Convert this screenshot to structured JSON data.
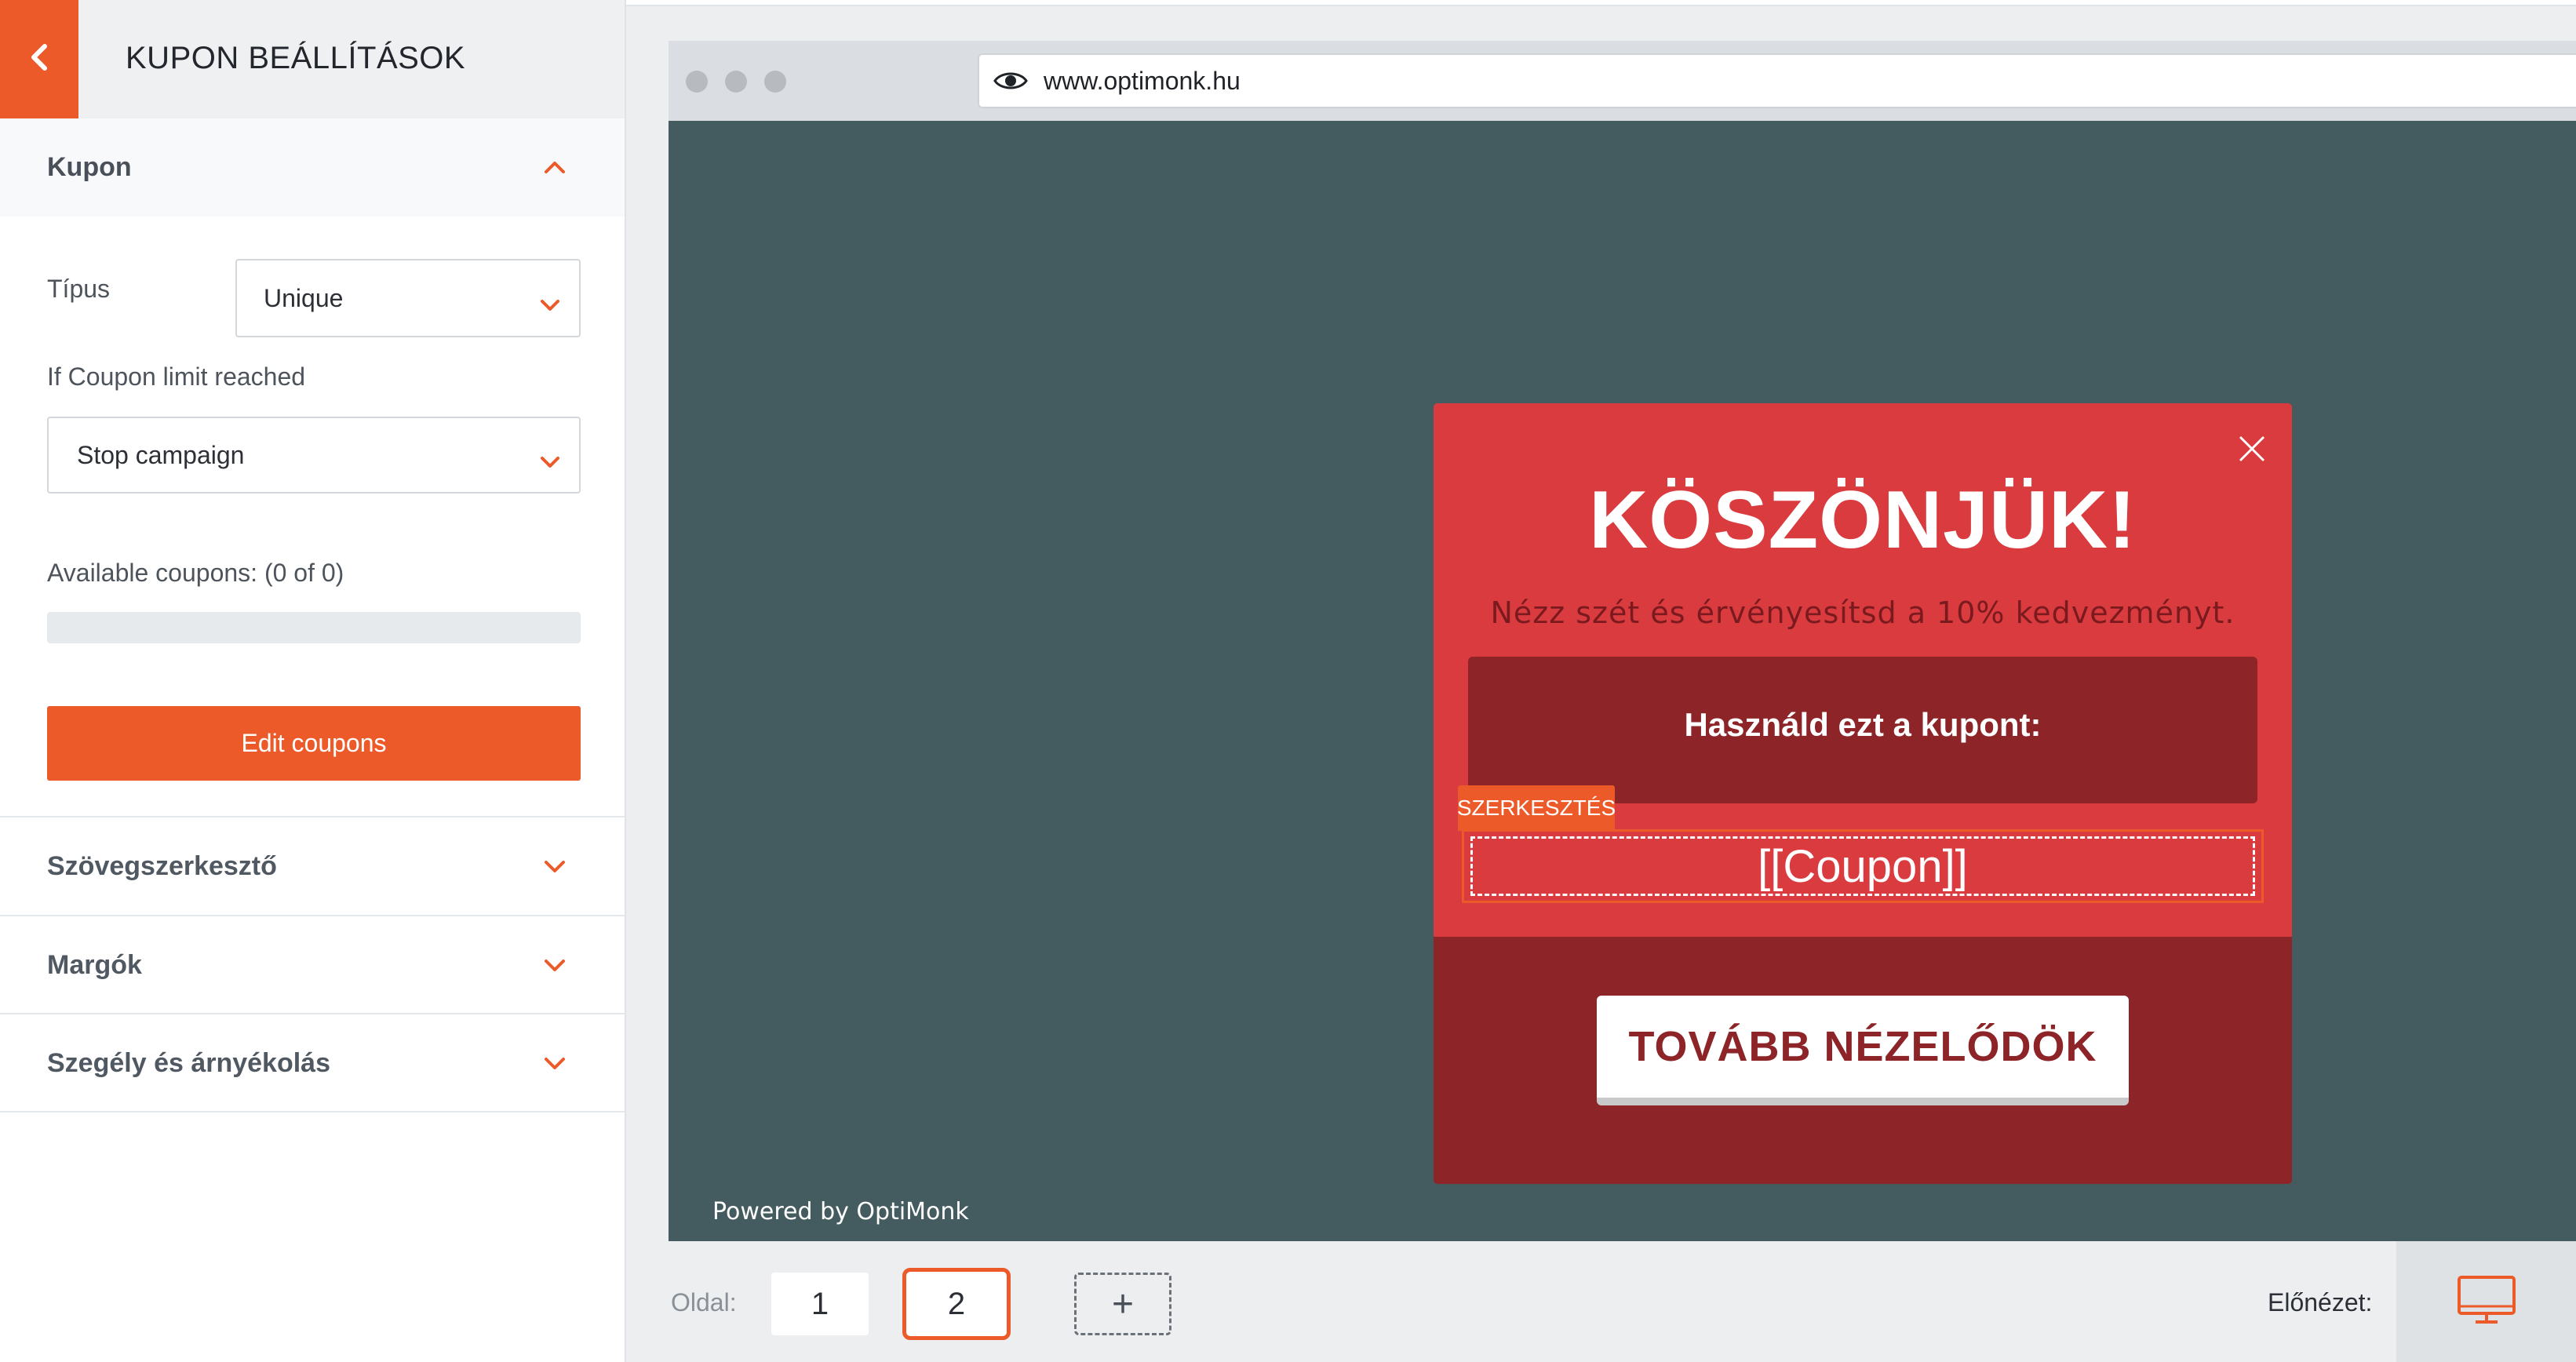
{
  "sidebar": {
    "title": "KUPON BEÁLLÍTÁSOK",
    "sections": {
      "kupon": {
        "label": "Kupon",
        "expanded": true,
        "tipus_label": "Típus",
        "tipus_value": "Unique",
        "limit_label": "If Coupon limit reached",
        "limit_value": "Stop campaign",
        "available_label": "Available coupons: (0 of 0)",
        "available_progress": 0,
        "edit_button": "Edit coupons"
      },
      "szovegszerkeszto": {
        "label": "Szövegszerkesztő"
      },
      "margok": {
        "label": "Margók"
      },
      "szegely": {
        "label": "Szegély és árnyékolás"
      }
    }
  },
  "browser": {
    "url": "www.optimonk.hu",
    "powered_by": "Powered by OptiMonk"
  },
  "popup": {
    "title": "KÖSZÖNJÜK!",
    "subtitle": "Nézz szét és érvényesítsd a 10% kedvezményt.",
    "coupon_prompt": "Használd ezt a kupont:",
    "edit_tag": "SZERKESZTÉS",
    "coupon_code": "[[Coupon]]",
    "cta": "TOVÁBB NÉZELŐDÖK"
  },
  "footer": {
    "page_label": "Oldal:",
    "pages": [
      "1",
      "2"
    ],
    "active_page": "2",
    "add_page": "+",
    "preview_label": "Előnézet:"
  },
  "colors": {
    "accent": "#ec5a29",
    "popup_red": "#d93b3e",
    "popup_dark_red": "#8c2428",
    "viewport_bg": "#445b60"
  },
  "icons": {
    "back": "chevron-left-icon",
    "section_toggle": "chevron-icon",
    "select": "chevron-down-icon",
    "url": "eye-icon",
    "close": "close-icon",
    "device": "desktop-icon"
  }
}
